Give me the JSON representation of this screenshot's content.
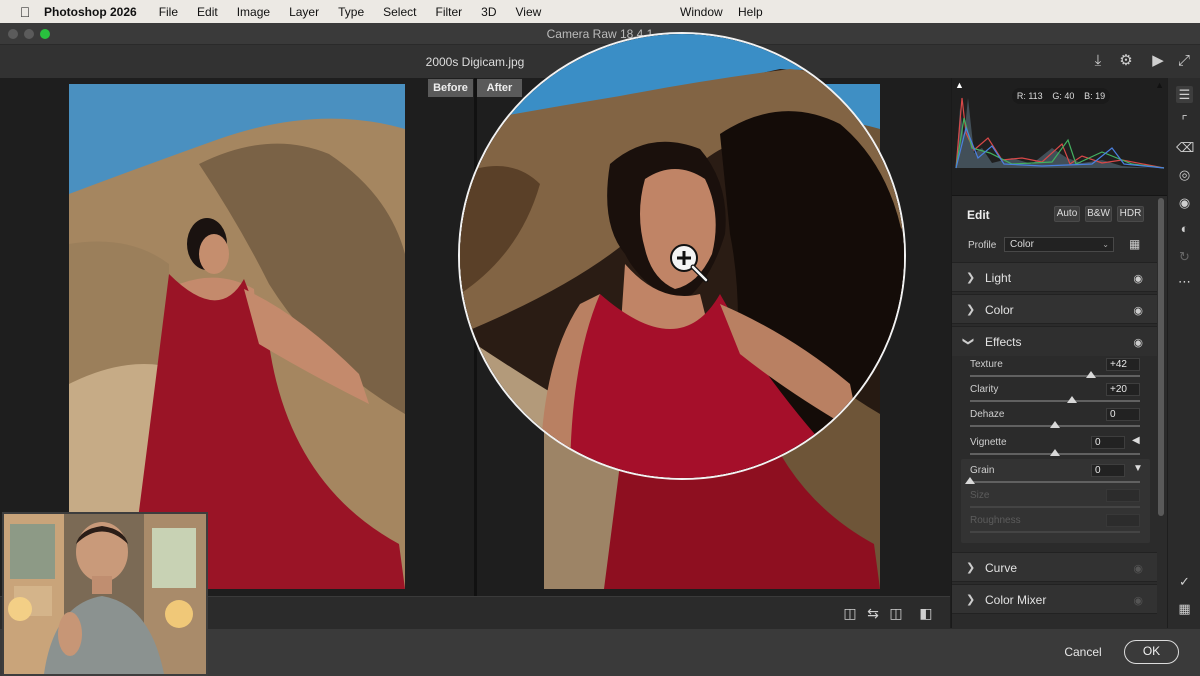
{
  "menubar": {
    "app": "Photoshop 2026",
    "items": [
      "File",
      "Edit",
      "Image",
      "Layer",
      "Type",
      "Select",
      "Filter",
      "3D",
      "View"
    ],
    "right_items": [
      "Window",
      "Help"
    ]
  },
  "window": {
    "title": "Camera Raw 18.4.1"
  },
  "file": {
    "name": "2000s Digicam.jpg"
  },
  "compare": {
    "before_label": "Before",
    "after_label": "After"
  },
  "histogram": {
    "r_label": "R:",
    "r": "113",
    "g_label": "G:",
    "g": "40",
    "b_label": "B:",
    "b": "19"
  },
  "edit": {
    "title": "Edit",
    "auto_label": "Auto",
    "bw_label": "B&W",
    "hdr_label": "HDR",
    "profile_label": "Profile",
    "profile_value": "Color"
  },
  "sections": {
    "light": "Light",
    "color": "Color",
    "effects": "Effects",
    "curve": "Curve",
    "color_mixer": "Color Mixer"
  },
  "effects": {
    "texture": {
      "label": "Texture",
      "value": "+42",
      "level": 0.71
    },
    "clarity": {
      "label": "Clarity",
      "value": "+20",
      "level": 0.6
    },
    "dehaze": {
      "label": "Dehaze",
      "value": "0",
      "level": 0.5
    },
    "vignette": {
      "label": "Vignette",
      "value": "0",
      "level": 0.5
    },
    "grain": {
      "label": "Grain",
      "value": "0",
      "level": 0.0
    },
    "size": {
      "label": "Size"
    },
    "roughness": {
      "label": "Roughness"
    }
  },
  "footer": {
    "cancel_label": "Cancel",
    "ok_label": "OK"
  },
  "colors": {
    "sky": "#3f8fc4",
    "rock": "#8a7455",
    "dress": "#9a1426",
    "panel": "#2b2b2b"
  }
}
